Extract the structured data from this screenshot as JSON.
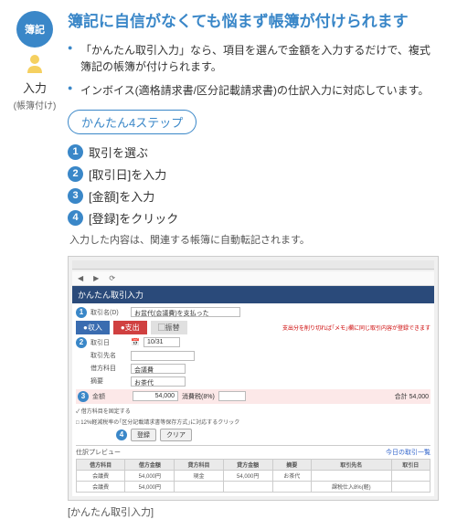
{
  "logo_text": "簿記",
  "left": {
    "title": "入力",
    "subtitle": "(帳簿付け)"
  },
  "heading": "簿記に自信がなくても悩まず帳簿が付けられます",
  "bullets": [
    "「かんたん取引入力」なら、項目を選んで金額を入力するだけで、複式簿記の帳簿が付けられます。",
    "インボイス(適格請求書/区分記載請求書)の仕訳入力に対応しています。"
  ],
  "step_box": "かんたん4ステップ",
  "steps": [
    "取引を選ぶ",
    "[取引日]を入力",
    "[金額]を入力",
    "[登録]をクリック"
  ],
  "note": "入力した内容は、関連する帳簿に自動転記されます。",
  "screenshot": {
    "header": "かんたん取引入力",
    "row1_label": "取引名(D)",
    "row1_value": "お盆代(会議費)を支払った",
    "tabs": {
      "income": "●収入",
      "expense": "●支出",
      "transfer": "▢振替"
    },
    "red_note": "支出分を削り切れば｢メモ｣欄に同じ取引内容が登録できます",
    "fields": {
      "date_label": "取引日",
      "date_value": "10/31",
      "client_label": "取引先名",
      "client_value": "",
      "debit_label": "借方科目",
      "debit_value": "会議費",
      "summary_label": "摘要",
      "summary_value": "お茶代",
      "amount_label": "金額",
      "amount_val": "54,000",
      "tax_label": "消費税(8%)",
      "tax_total": "合計  54,000"
    },
    "checks": {
      "c1": "✓ 借方科目を固定する",
      "c2": "□ 12%軽減税率の｢区分記載請求書等保存方式｣に対応するクリック"
    },
    "buttons": {
      "register": "登録",
      "clear": "クリア"
    },
    "table_title": "仕訳プレビュー",
    "table_link": "今日の取引一覧",
    "table": {
      "headers": [
        "借方科目",
        "借方金額",
        "貸方科目",
        "貸方金額",
        "摘要",
        "取引先名",
        "取引日"
      ],
      "rows": [
        [
          "会議費",
          "54,000円",
          "現金",
          "54,000円",
          "お茶代",
          "",
          ""
        ],
        [
          "会議費",
          "54,000円",
          "",
          "",
          "",
          "課税仕入8%(軽)",
          ""
        ]
      ]
    }
  },
  "caption": "[かんたん取引入力]"
}
